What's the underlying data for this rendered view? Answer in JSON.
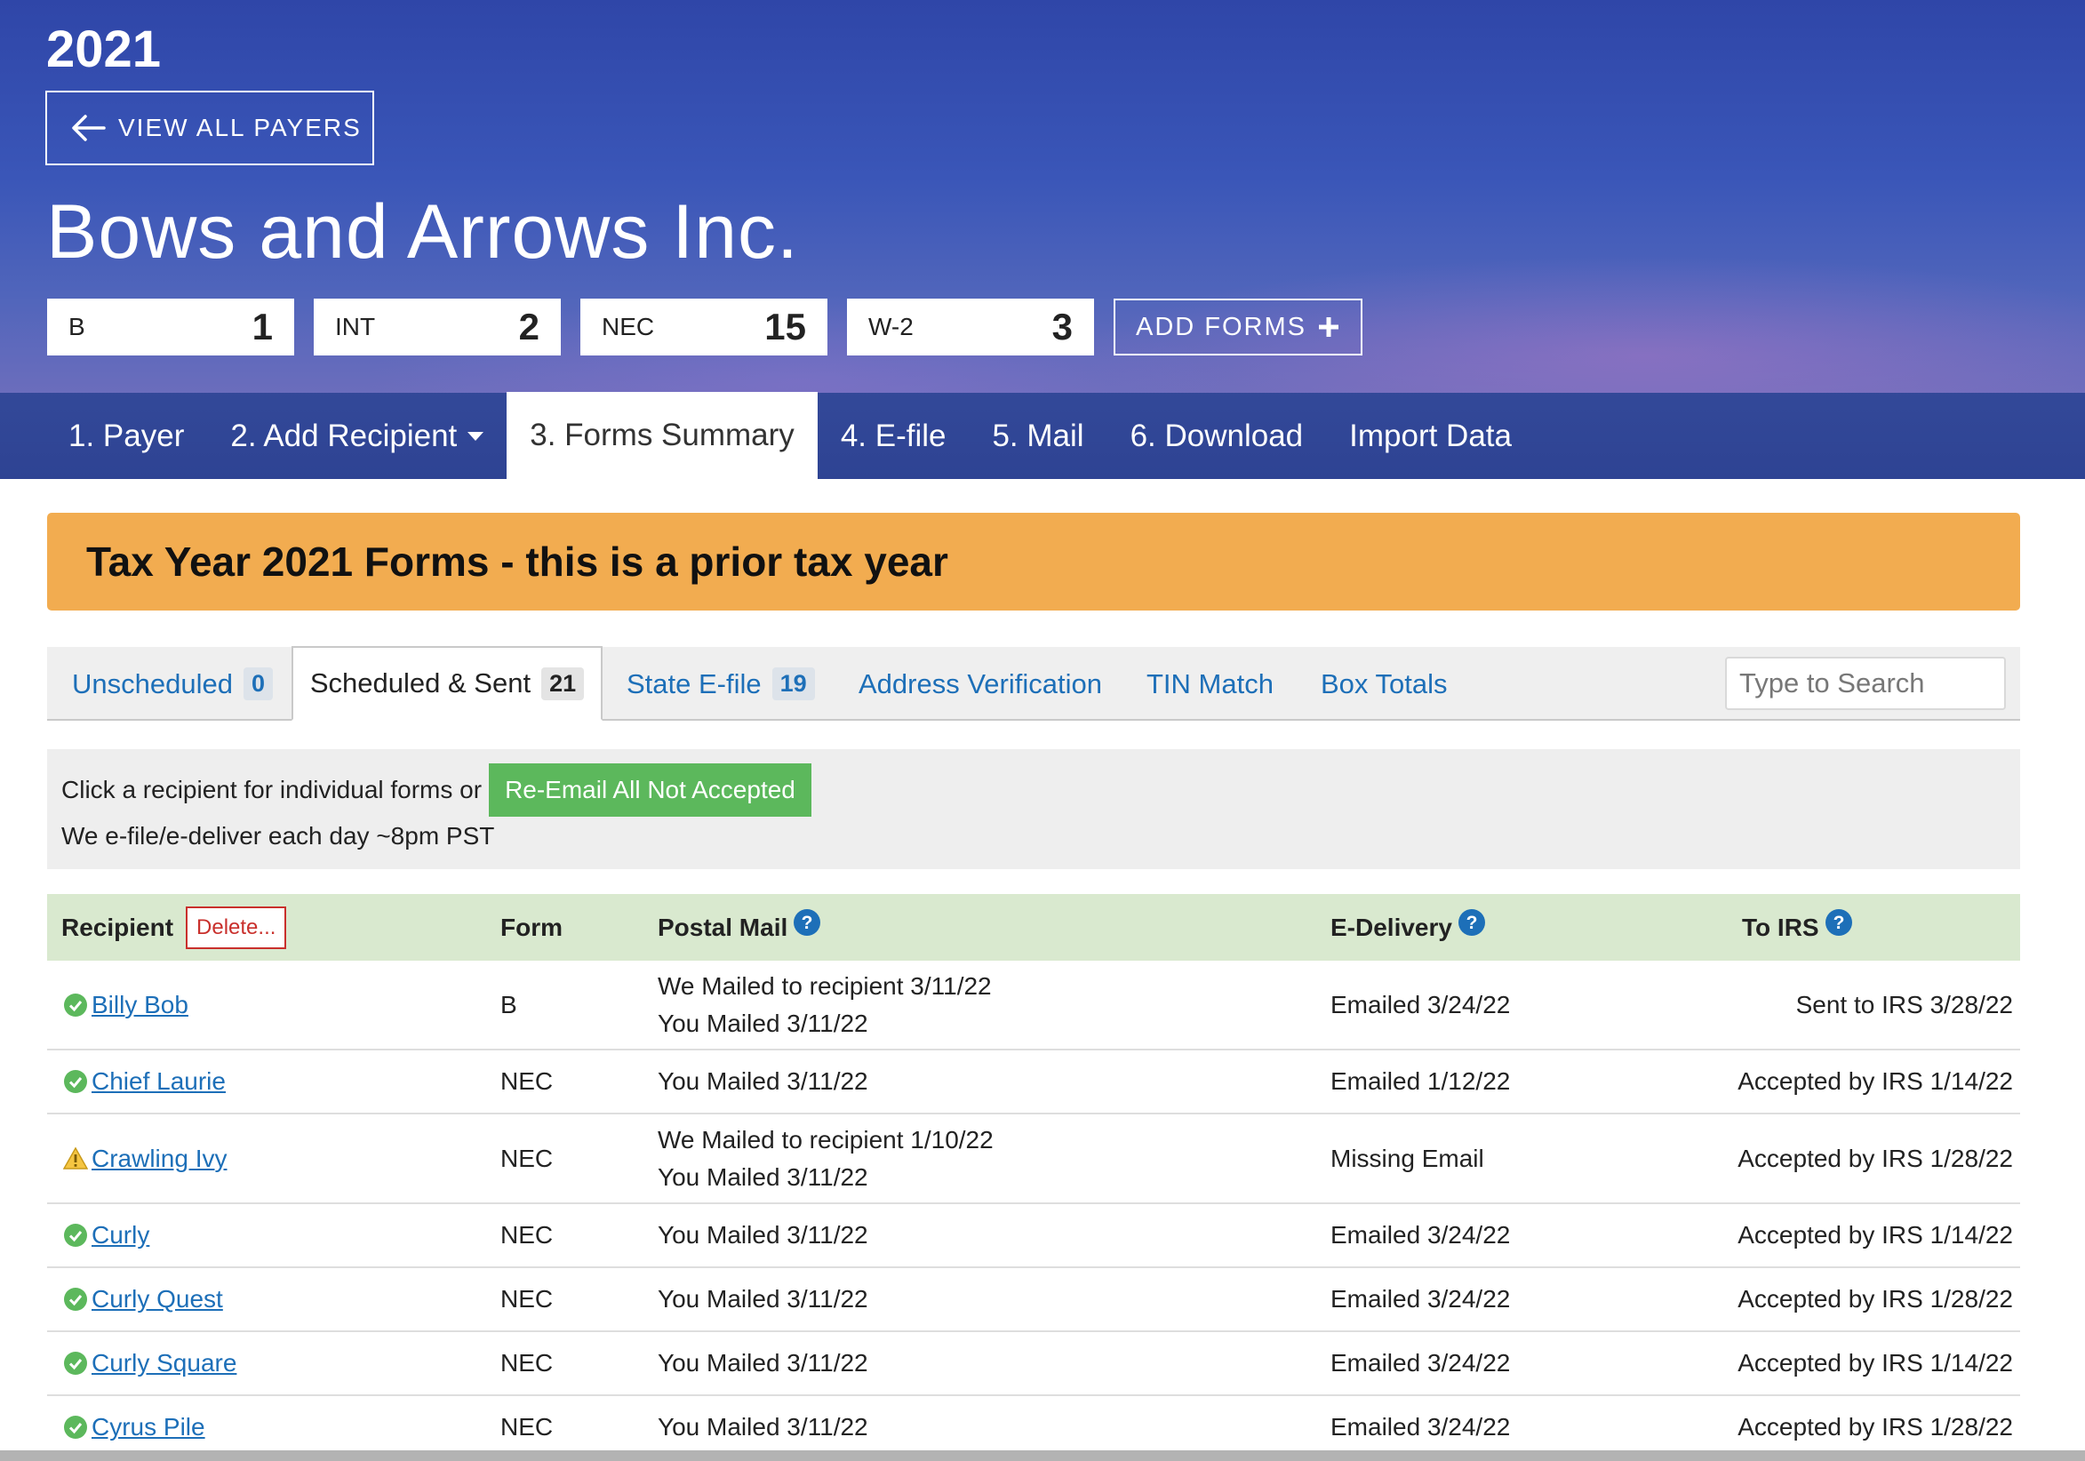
{
  "header": {
    "year": "2021",
    "view_all_label": "VIEW ALL PAYERS",
    "payer_name": "Bows and Arrows Inc.",
    "form_counts": [
      {
        "label": "B",
        "count": "1"
      },
      {
        "label": "INT",
        "count": "2"
      },
      {
        "label": "NEC",
        "count": "15"
      },
      {
        "label": "W-2",
        "count": "3"
      }
    ],
    "add_forms_label": "ADD FORMS"
  },
  "nav": {
    "items": [
      {
        "label": "1. Payer"
      },
      {
        "label": "2. Add Recipient"
      },
      {
        "label": "3. Forms Summary"
      },
      {
        "label": "4. E-file"
      },
      {
        "label": "5. Mail"
      },
      {
        "label": "6. Download"
      },
      {
        "label": "Import Data"
      }
    ],
    "active": "3. Forms Summary"
  },
  "banner": {
    "text": "Tax Year 2021 Forms - this is a prior tax year",
    "color": "#f2ac50"
  },
  "tabs": {
    "items": [
      {
        "label": "Unscheduled",
        "badge": "0"
      },
      {
        "label": "Scheduled & Sent",
        "badge": "21"
      },
      {
        "label": "State E-file",
        "badge": "19"
      },
      {
        "label": "Address Verification"
      },
      {
        "label": "TIN Match"
      },
      {
        "label": "Box Totals"
      }
    ],
    "active": "Scheduled & Sent",
    "search_placeholder": "Type to Search"
  },
  "info": {
    "line1": "Click a recipient for individual forms or",
    "reemail_label": "Re-Email All Not Accepted",
    "line2": "We e-file/e-deliver each day ~8pm PST"
  },
  "table": {
    "headers": {
      "recipient": "Recipient",
      "delete": "Delete...",
      "form": "Form",
      "postal": "Postal Mail",
      "edelivery": "E-Delivery",
      "irs": "To IRS"
    },
    "rows": [
      {
        "status": "ok",
        "recipient": "Billy Bob",
        "form": "B",
        "postal_1": "We Mailed to recipient 3/11/22",
        "postal_2": "You Mailed 3/11/22",
        "edelivery": "Emailed 3/24/22",
        "irs": "Sent to IRS 3/28/22"
      },
      {
        "status": "ok",
        "recipient": "Chief Laurie",
        "form": "NEC",
        "postal_1": "You Mailed 3/11/22",
        "postal_2": "",
        "edelivery": "Emailed 1/12/22",
        "irs": "Accepted by IRS 1/14/22"
      },
      {
        "status": "warning",
        "recipient": "Crawling Ivy",
        "form": "NEC",
        "postal_1": "We Mailed to recipient 1/10/22",
        "postal_2": "You Mailed 3/11/22",
        "edelivery": "Missing Email",
        "irs": "Accepted by IRS 1/28/22"
      },
      {
        "status": "ok",
        "recipient": "Curly",
        "form": "NEC",
        "postal_1": "You Mailed 3/11/22",
        "postal_2": "",
        "edelivery": "Emailed 3/24/22",
        "irs": "Accepted by IRS 1/14/22"
      },
      {
        "status": "ok",
        "recipient": "Curly Quest",
        "form": "NEC",
        "postal_1": "You Mailed 3/11/22",
        "postal_2": "",
        "edelivery": "Emailed 3/24/22",
        "irs": "Accepted by IRS 1/28/22"
      },
      {
        "status": "ok",
        "recipient": "Curly Square",
        "form": "NEC",
        "postal_1": "You Mailed 3/11/22",
        "postal_2": "",
        "edelivery": "Emailed 3/24/22",
        "irs": "Accepted by IRS 1/14/22"
      },
      {
        "status": "ok",
        "recipient": "Cyrus Pile",
        "form": "NEC",
        "postal_1": "You Mailed 3/11/22",
        "postal_2": "",
        "edelivery": "Emailed 3/24/22",
        "irs": "Accepted by IRS 1/28/22"
      }
    ]
  },
  "colors": {
    "accent_link": "#1d6fb8",
    "success": "#5cb85c",
    "header_row": "#d9e9cf",
    "danger": "#c9302c"
  },
  "icons": {
    "back": "arrow-left-icon",
    "add": "plus-icon",
    "help": "question-circle-icon",
    "ok": "check-circle-icon",
    "warning": "warning-triangle-icon"
  }
}
